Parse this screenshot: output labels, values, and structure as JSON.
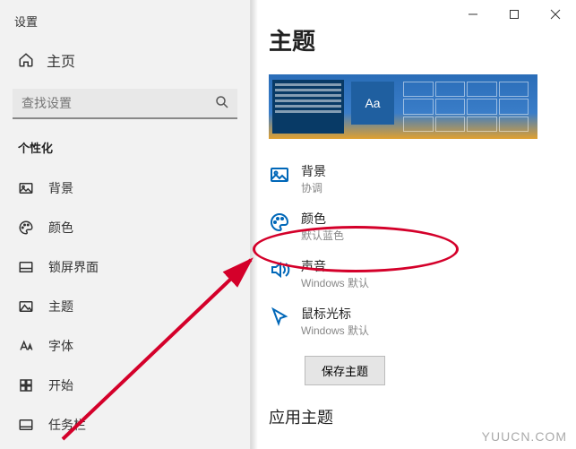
{
  "app_title": "设置",
  "home_label": "主页",
  "search": {
    "placeholder": "查找设置"
  },
  "group": "个性化",
  "nav": {
    "background": "背景",
    "color": "颜色",
    "lockscreen": "锁屏界面",
    "theme": "主题",
    "font": "字体",
    "start": "开始",
    "taskbar": "任务栏"
  },
  "page_title": "主题",
  "preview_tile": "Aa",
  "settings": {
    "background": {
      "label": "背景",
      "sub": "协调"
    },
    "color": {
      "label": "颜色",
      "sub": "默认蓝色"
    },
    "sound": {
      "label": "声音",
      "sub": "Windows 默认"
    },
    "cursor": {
      "label": "鼠标光标",
      "sub": "Windows 默认"
    }
  },
  "save_btn": "保存主题",
  "apply_section": "应用主题",
  "watermark": "YUUCN.COM"
}
